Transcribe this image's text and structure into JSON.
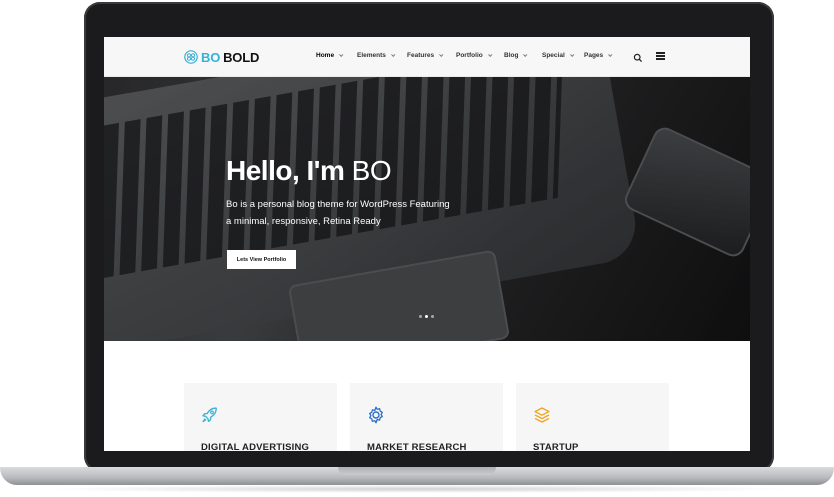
{
  "brand": {
    "prefix": "BO",
    "name": "BOLD"
  },
  "nav": {
    "items": [
      {
        "label": "Home",
        "active": true
      },
      {
        "label": "Elements"
      },
      {
        "label": "Features"
      },
      {
        "label": "Portfolio"
      },
      {
        "label": "Blog"
      },
      {
        "label": "Special"
      },
      {
        "label": "Pages"
      }
    ]
  },
  "hero": {
    "title_bold": "Hello, I'm",
    "title_light": "BO",
    "subtitle": "Bo is a personal blog theme for WordPress Featuring a minimal, responsive, Retina Ready",
    "button_label": "Lets View Portfolio",
    "slides_count": 3,
    "active_slide": 2
  },
  "features": [
    {
      "title": "DIGITAL ADVERTISING",
      "icon": "rocket-icon",
      "color": "#35b0d6"
    },
    {
      "title": "MARKET RESEARCH",
      "icon": "gear-icon",
      "color": "#2f6fc7"
    },
    {
      "title": "STARTUP",
      "icon": "layers-icon",
      "color": "#f0a31c"
    }
  ],
  "colors": {
    "accent": "#35b0d6",
    "header_bg": "#f7f7f7",
    "card_bg": "#f6f6f6"
  }
}
